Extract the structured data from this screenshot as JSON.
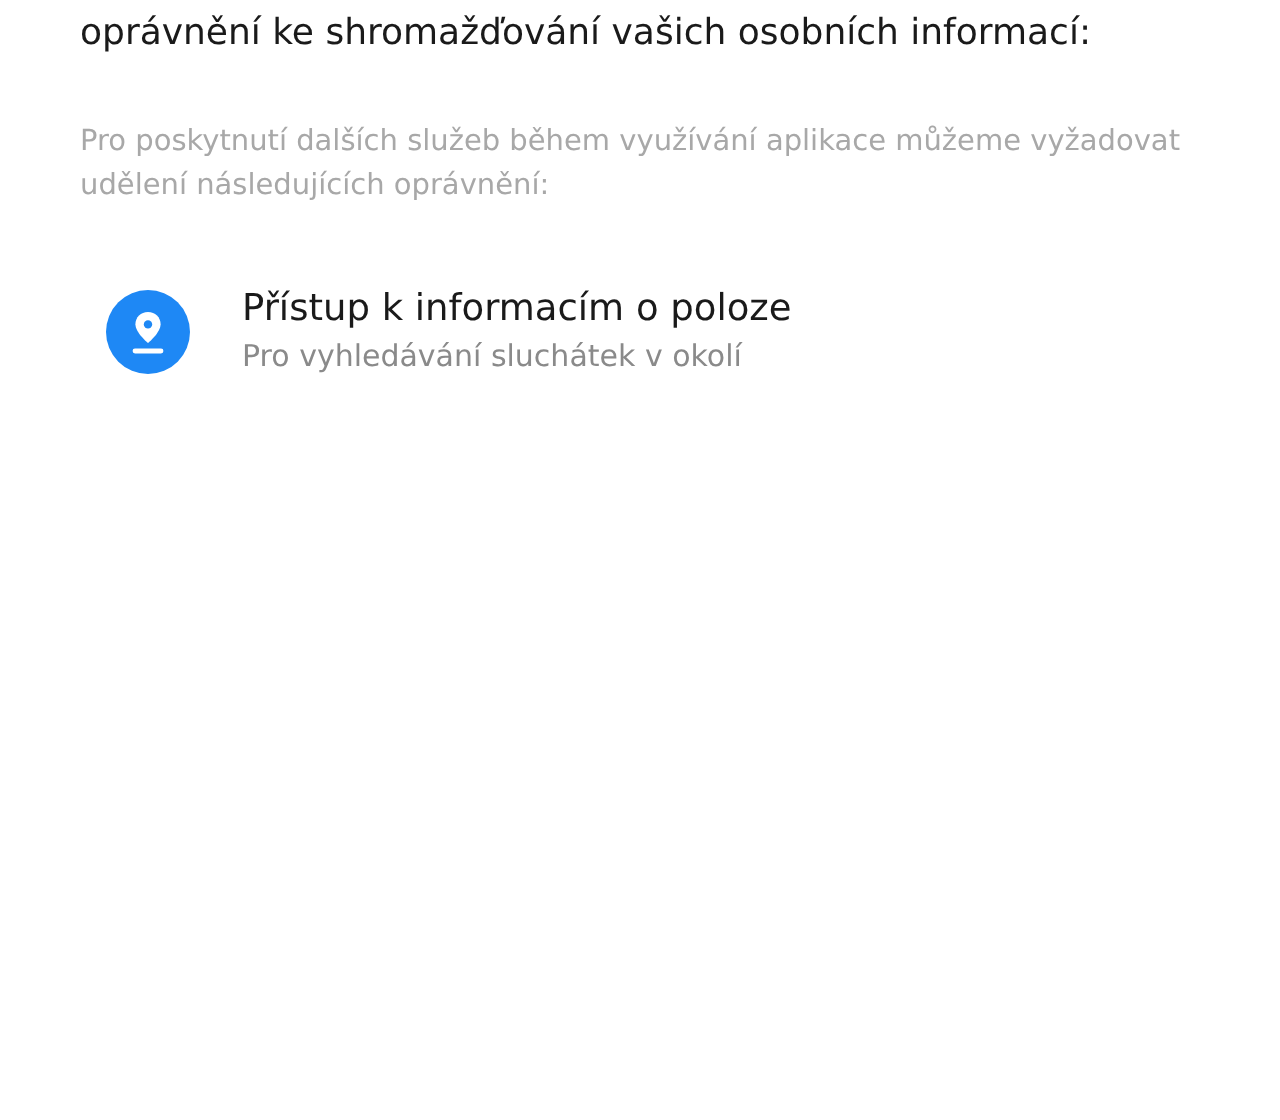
{
  "intro_tail": "oprávnění ke shromažďování vašich osobních informací:",
  "notice": "Pro poskytnutí dalších služeb během využívání aplikace můžeme vyžadovat udělení následujících oprávnění:",
  "permissions": [
    {
      "kind": "location",
      "title": "Přístup k informacím o poloze",
      "description": "Pro vyhledávání sluchátek v okolí"
    }
  ]
}
